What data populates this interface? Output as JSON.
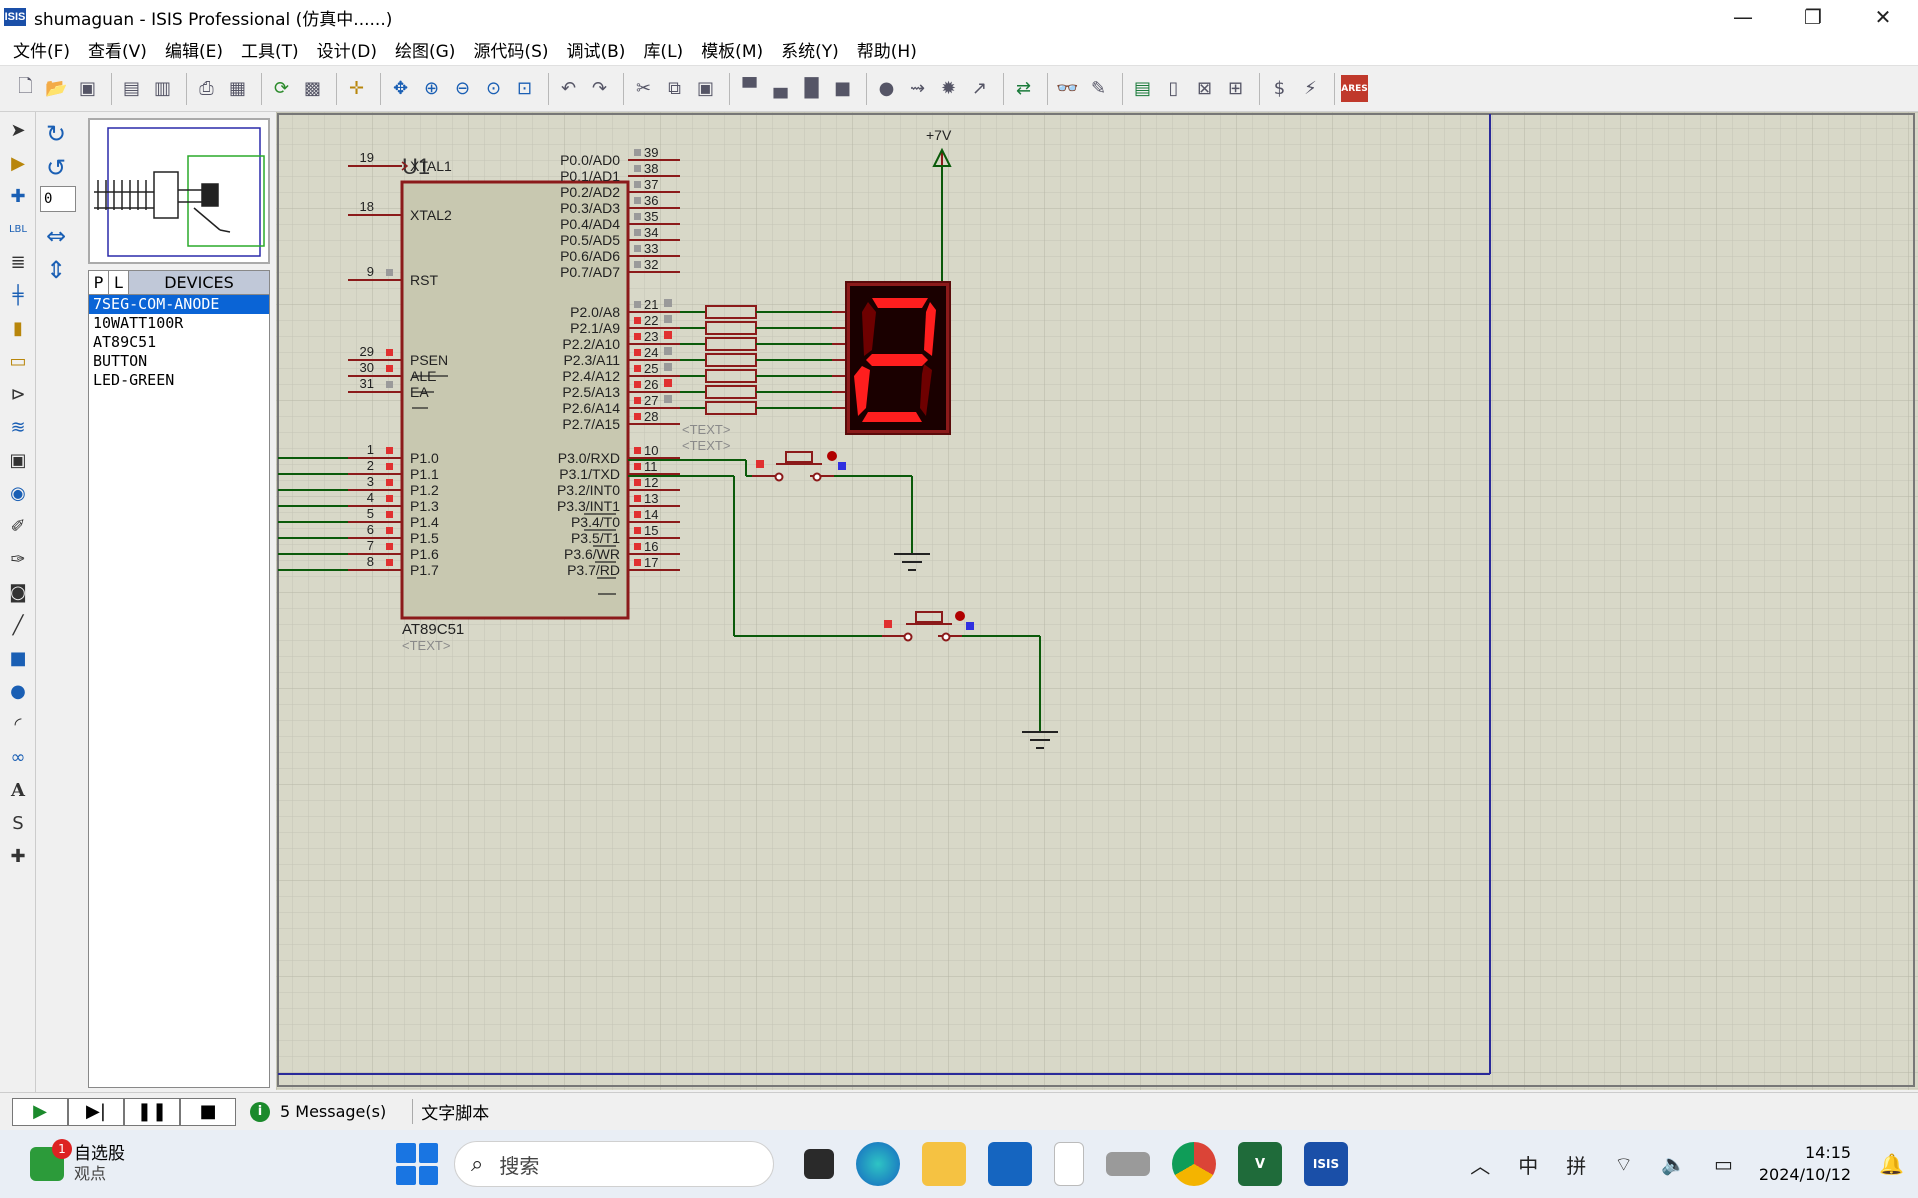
{
  "window": {
    "logo": "ISIS",
    "title": "shumaguan - ISIS Professional (仿真中......)",
    "minimize": "—",
    "maximize": "❐",
    "close": "✕"
  },
  "menu": [
    "文件(F)",
    "查看(V)",
    "编辑(E)",
    "工具(T)",
    "设计(D)",
    "绘图(G)",
    "源代码(S)",
    "调试(B)",
    "库(L)",
    "模板(M)",
    "系统(Y)",
    "帮助(H)"
  ],
  "rotation": {
    "value": "0"
  },
  "devices": {
    "tab_p": "P",
    "tab_l": "L",
    "title": "DEVICES",
    "items": [
      "7SEG-COM-ANODE",
      "10WATT100R",
      "AT89C51",
      "BUTTON",
      "LED-GREEN"
    ],
    "selected_index": 0
  },
  "schematic": {
    "chip_ref": "U1",
    "chip_part": "AT89C51",
    "chip_text": "<TEXT>",
    "left_pins": [
      {
        "num": "19",
        "name": "XTAL1"
      },
      {
        "num": "18",
        "name": "XTAL2"
      },
      {
        "num": "9",
        "name": "RST"
      },
      {
        "num": "29",
        "name": "PSEN"
      },
      {
        "num": "30",
        "name": "ALE"
      },
      {
        "num": "31",
        "name": "EA"
      },
      {
        "num": "1",
        "name": "P1.0"
      },
      {
        "num": "2",
        "name": "P1.1"
      },
      {
        "num": "3",
        "name": "P1.2"
      },
      {
        "num": "4",
        "name": "P1.3"
      },
      {
        "num": "5",
        "name": "P1.4"
      },
      {
        "num": "6",
        "name": "P1.5"
      },
      {
        "num": "7",
        "name": "P1.6"
      },
      {
        "num": "8",
        "name": "P1.7"
      }
    ],
    "right_pins": [
      {
        "num": "39",
        "name": "P0.0/AD0"
      },
      {
        "num": "38",
        "name": "P0.1/AD1"
      },
      {
        "num": "37",
        "name": "P0.2/AD2"
      },
      {
        "num": "36",
        "name": "P0.3/AD3"
      },
      {
        "num": "35",
        "name": "P0.4/AD4"
      },
      {
        "num": "34",
        "name": "P0.5/AD5"
      },
      {
        "num": "33",
        "name": "P0.6/AD6"
      },
      {
        "num": "32",
        "name": "P0.7/AD7"
      },
      {
        "num": "21",
        "name": "P2.0/A8"
      },
      {
        "num": "22",
        "name": "P2.1/A9"
      },
      {
        "num": "23",
        "name": "P2.2/A10"
      },
      {
        "num": "24",
        "name": "P2.3/A11"
      },
      {
        "num": "25",
        "name": "P2.4/A12"
      },
      {
        "num": "26",
        "name": "P2.5/A13"
      },
      {
        "num": "27",
        "name": "P2.6/A14"
      },
      {
        "num": "28",
        "name": "P2.7/A15"
      },
      {
        "num": "10",
        "name": "P3.0/RXD"
      },
      {
        "num": "11",
        "name": "P3.1/TXD"
      },
      {
        "num": "12",
        "name": "P3.2/INT0"
      },
      {
        "num": "13",
        "name": "P3.3/INT1"
      },
      {
        "num": "14",
        "name": "P3.4/T0"
      },
      {
        "num": "15",
        "name": "P3.5/T1"
      },
      {
        "num": "16",
        "name": "P3.6/WR"
      },
      {
        "num": "17",
        "name": "P3.7/RD"
      }
    ],
    "resistor_text_1": "<TEXT>",
    "resistor_text_2": "<TEXT>",
    "power_label": "+7V",
    "seven_seg_digit": "2",
    "colors": {
      "background": "#d8d8c8",
      "grid": "#c2c2b4",
      "wire": "#0a5a0a",
      "component": "#8b1a1a",
      "chip_fill": "#c8c8b0",
      "segment_on": "#ff1e1e",
      "segment_off": "#6e0000",
      "sheet_border": "#2a2a9a"
    }
  },
  "status": {
    "messages": "5 Message(s)",
    "text": "文字脚本"
  },
  "taskbar": {
    "stock_badge": "1",
    "stock_title": "自选股",
    "stock_sub": "观点",
    "search_placeholder": "搜索",
    "ime_lang": "中",
    "ime_mode": "拼",
    "time": "14:15",
    "date": "2024/10/12"
  }
}
